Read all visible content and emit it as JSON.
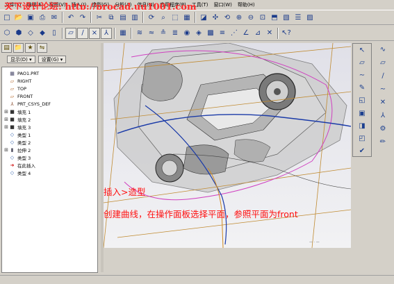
{
  "menubar": {
    "items": [
      "文件(F)",
      "编辑(E)",
      "视图(V)",
      "插入(I)",
      "造型(G)",
      "分析(A)",
      "信息(N)",
      "应用程序(P)",
      "工具(T)",
      "窗口(W)",
      "帮助(H)"
    ]
  },
  "watermark": "天下设计论坛: http://procad.uu1001.com",
  "navigator": {
    "display_dropdown": "显示(D) ▾",
    "settings_dropdown": "设置(G) ▾"
  },
  "model_tree": {
    "items": [
      {
        "label": "PAO1.PRT",
        "icon": "part-icon",
        "expandable": false
      },
      {
        "label": "RIGHT",
        "icon": "datum-plane-icon",
        "expandable": false
      },
      {
        "label": "TOP",
        "icon": "datum-plane-icon",
        "expandable": false
      },
      {
        "label": "FRONT",
        "icon": "datum-plane-icon",
        "expandable": false
      },
      {
        "label": "PRT_CSYS_DEF",
        "icon": "csys-icon",
        "expandable": false
      },
      {
        "label": "填充 1",
        "icon": "fill-icon",
        "expandable": true
      },
      {
        "label": "填充 2",
        "icon": "fill-icon",
        "expandable": true
      },
      {
        "label": "填充 3",
        "icon": "fill-icon",
        "expandable": true
      },
      {
        "label": "类型 1",
        "icon": "style-icon",
        "expandable": false
      },
      {
        "label": "类型 2",
        "icon": "style-icon",
        "expandable": false
      },
      {
        "label": "拉伸 2",
        "icon": "extrude-icon",
        "expandable": true
      },
      {
        "label": "类型 3",
        "icon": "style-icon",
        "expandable": false
      },
      {
        "label": "在此插入",
        "icon": "insert-here-icon",
        "expandable": false
      },
      {
        "label": "类型 4",
        "icon": "style-icon",
        "expandable": false
      }
    ]
  },
  "annotation": {
    "line1": "插入>造型",
    "line2": "创建曲线，在操作面板选择平面，参照平面为front"
  },
  "colors": {
    "annotation_red": "#ff1010",
    "watermark_red": "#ff2a2a",
    "curve_blue": "#1a3aa8",
    "curve_magenta": "#d040c0",
    "curve_orange": "#d08a20"
  }
}
